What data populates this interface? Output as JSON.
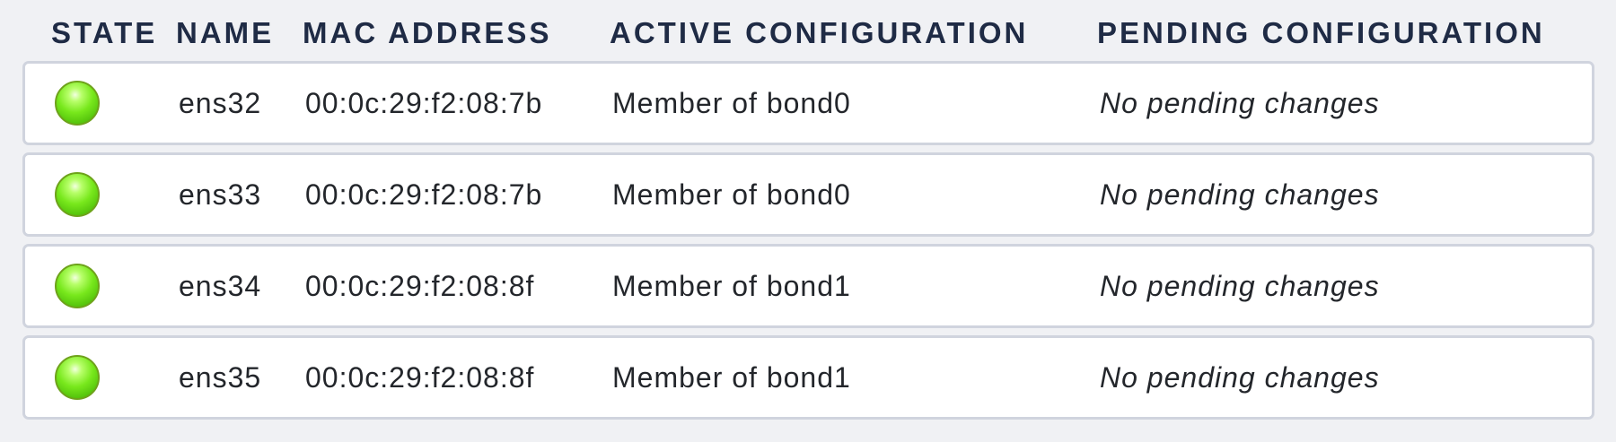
{
  "columns": {
    "state": "STATE",
    "name": "NAME",
    "mac": "MAC ADDRESS",
    "active": "ACTIVE CONFIGURATION",
    "pending": "PENDING CONFIGURATION"
  },
  "status_color": "#66dd11",
  "rows": [
    {
      "state": "up",
      "name": "ens32",
      "mac": "00:0c:29:f2:08:7b",
      "active": "Member of bond0",
      "pending": "No pending changes"
    },
    {
      "state": "up",
      "name": "ens33",
      "mac": "00:0c:29:f2:08:7b",
      "active": "Member of bond0",
      "pending": "No pending changes"
    },
    {
      "state": "up",
      "name": "ens34",
      "mac": "00:0c:29:f2:08:8f",
      "active": "Member of bond1",
      "pending": "No pending changes"
    },
    {
      "state": "up",
      "name": "ens35",
      "mac": "00:0c:29:f2:08:8f",
      "active": "Member of bond1",
      "pending": "No pending changes"
    }
  ]
}
